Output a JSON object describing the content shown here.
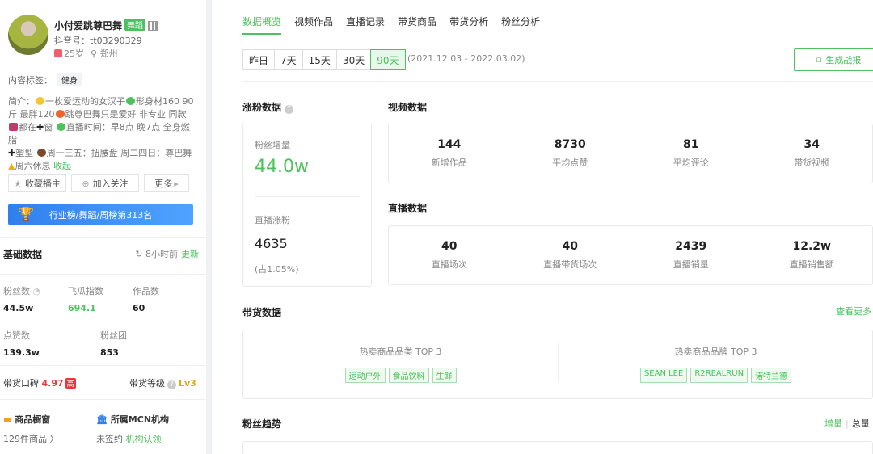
{
  "profile": {
    "name": "小付爱跳尊巴舞",
    "category_tag": "舞蹈",
    "douyin_id": "抖音号：tt03290329",
    "age": "25岁",
    "location": "郑州",
    "content_tag_label": "内容标签：",
    "content_tag": "健身",
    "bio_parts": [
      "简介：",
      "一枚爱运动的女汉子",
      "形身材160 90斤 最胖120",
      "跳尊巴舞只是爱好 非专业 同款",
      "都在",
      "窗",
      "直播时间：早8点 晚7点 全身燃脂",
      "塑型",
      "周一三五：扭腰盘 周二四日：尊巴舞",
      "周六休息"
    ],
    "bio_fold": "收起"
  },
  "buttons": {
    "favorite": "收藏播主",
    "follow": "加入关注",
    "more": "更多"
  },
  "rank_label": "行业榜/舞蹈/周榜第313名",
  "basic": {
    "title": "基础数据",
    "updated": "8小时前",
    "update_link": "更新",
    "fans_label": "粉丝数",
    "fans_value": "44.5w",
    "feigua_label": "飞瓜指数",
    "feigua_value": "694.1",
    "works_label": "作品数",
    "works_value": "60",
    "likes_label": "点赞数",
    "likes_value": "139.3w",
    "fanclub_label": "粉丝团",
    "fanclub_value": "853",
    "reputation_label": "带货口碑",
    "reputation_value": "4.97",
    "reputation_badge": "高",
    "level_label": "带货等级",
    "level_value": "Lv3",
    "shop_title": "商品橱窗",
    "shop_value": "129件商品",
    "mcn_title": "所属MCN机构",
    "mcn_value": "未签约",
    "mcn_link": "机构认领"
  },
  "tabs": [
    "数据概览",
    "视频作品",
    "直播记录",
    "带货商品",
    "带货分析",
    "粉丝分析"
  ],
  "ranges": [
    "昨日",
    "7天",
    "15天",
    "30天",
    "90天"
  ],
  "date_range": "(2021.12.03 - 2022.03.02)",
  "generate_report": "生成战报",
  "fans_growth": {
    "title": "涨粉数据",
    "fans_increase_label": "粉丝增量",
    "fans_increase_value": "44.0w",
    "live_increase_label": "直播涨粉",
    "live_increase_value": "4635",
    "live_increase_pct": "(占1.05%)"
  },
  "video": {
    "title": "视频数据",
    "items": [
      {
        "value": "144",
        "label": "新增作品"
      },
      {
        "value": "8730",
        "label": "平均点赞"
      },
      {
        "value": "81",
        "label": "平均评论"
      },
      {
        "value": "34",
        "label": "带货视频"
      }
    ]
  },
  "live": {
    "title": "直播数据",
    "items": [
      {
        "value": "40",
        "label": "直播场次"
      },
      {
        "value": "40",
        "label": "直播带货场次"
      },
      {
        "value": "2439",
        "label": "直播销量"
      },
      {
        "value": "12.2w",
        "label": "直播销售额"
      }
    ]
  },
  "goods": {
    "title": "带货数据",
    "more": "查看更多",
    "cat_title": "热卖商品品类 TOP 3",
    "cats": [
      "运动户外",
      "食品饮料",
      "生鲜"
    ],
    "brand_title": "热卖商品品牌 TOP 3",
    "brands": [
      "SEAN LEE",
      "R2REALRUN",
      "诺特兰德"
    ]
  },
  "trend": {
    "title": "粉丝趋势",
    "increase": "增量",
    "total": "总量"
  },
  "colors": {
    "accent": "#4cc15d",
    "rank_blue": "#2f80ed",
    "red": "#e6393b",
    "gold": "#e0a526"
  }
}
